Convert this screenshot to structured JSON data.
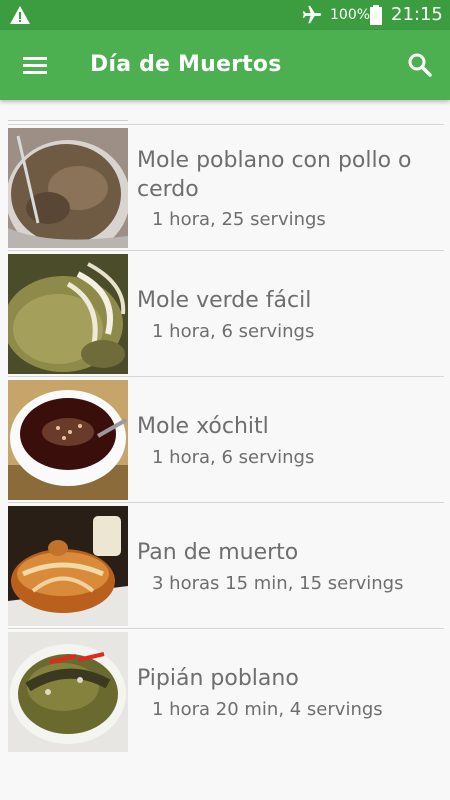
{
  "status_bar": {
    "battery_percent": "100%",
    "time": "21:15",
    "icons": [
      "warning-icon",
      "airplane-mode-icon",
      "battery-icon"
    ]
  },
  "toolbar": {
    "title": "Día de Muertos",
    "menu_icon": "hamburger-menu-icon",
    "search_icon": "search-icon"
  },
  "recipes": [
    {
      "title": "Mole poblano con pollo o cerdo",
      "meta": "1 hora, 25 servings"
    },
    {
      "title": "Mole verde fácil",
      "meta": "1 hora, 6 servings"
    },
    {
      "title": "Mole xóchitl",
      "meta": "1 hora, 6 servings"
    },
    {
      "title": "Pan de muerto",
      "meta": "3 horas 15 min, 15 servings"
    },
    {
      "title": "Pipián poblano",
      "meta": "1 hora 20 min, 4 servings"
    }
  ],
  "colors": {
    "status_bar": "#3c9d40",
    "toolbar": "#4caf50",
    "background": "#f8f8f8",
    "text": "#6e6e6e"
  }
}
